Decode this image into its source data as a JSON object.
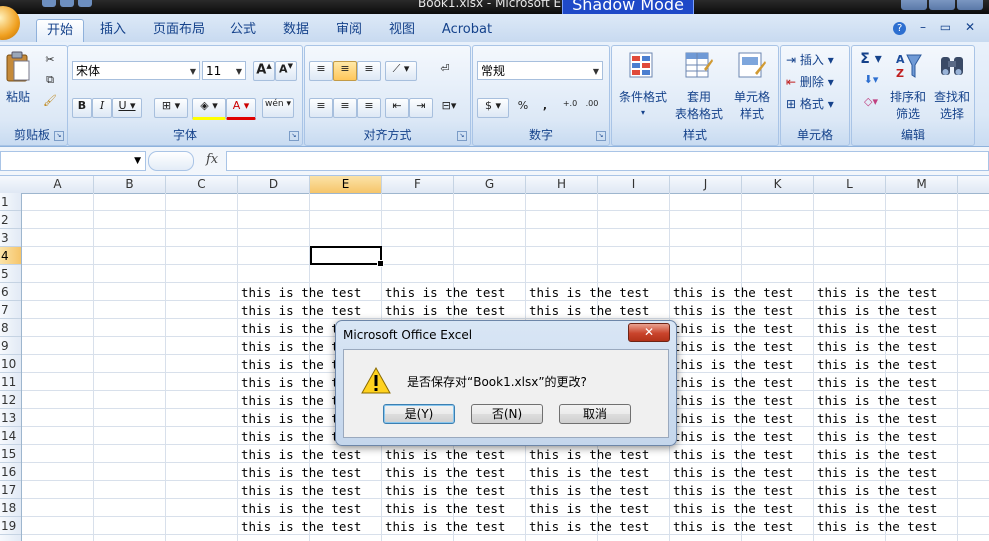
{
  "window": {
    "title": "Book1.xlsx - Microsoft E",
    "overlay_label": "Shadow Mode"
  },
  "tabs": [
    {
      "label": "开始",
      "active": true
    },
    {
      "label": "插入"
    },
    {
      "label": "页面布局"
    },
    {
      "label": "公式"
    },
    {
      "label": "数据"
    },
    {
      "label": "审阅"
    },
    {
      "label": "视图"
    },
    {
      "label": "Acrobat"
    }
  ],
  "ribbon": {
    "clipboard": {
      "label": "剪贴板",
      "paste_label": "粘贴"
    },
    "font": {
      "label": "字体",
      "font_name": "宋体",
      "font_size": "11"
    },
    "alignment": {
      "label": "对齐方式"
    },
    "number": {
      "label": "数字",
      "format": "常规",
      "percent": "%",
      "comma": ","
    },
    "styles": {
      "label": "样式",
      "conditional": "条件格式",
      "table_format_1": "套用",
      "table_format_2": "表格格式",
      "cell_styles_1": "单元格",
      "cell_styles_2": "样式"
    },
    "cells": {
      "label": "单元格",
      "insert": "插入",
      "delete": "删除",
      "format": "格式"
    },
    "editing": {
      "label": "编辑",
      "sum": "Σ",
      "sort_1": "排序和",
      "sort_2": "筛选",
      "find_1": "查找和",
      "find_2": "选择"
    }
  },
  "formula_bar": {
    "fx": "fx",
    "name_box": "",
    "formula": ""
  },
  "grid": {
    "columns": [
      "A",
      "B",
      "C",
      "D",
      "E",
      "F",
      "G",
      "H",
      "I",
      "J",
      "K",
      "L",
      "M"
    ],
    "rows": [
      "1",
      "2",
      "3",
      "4",
      "5",
      "6",
      "7",
      "8",
      "9",
      "10",
      "11",
      "12",
      "13",
      "14",
      "15",
      "16",
      "17",
      "18",
      "19"
    ],
    "selected_column": "E",
    "selected_row": "4",
    "active_cell": "E4",
    "cell_text": "this is the test"
  },
  "dialog": {
    "title": "Microsoft Office Excel",
    "close": "✕",
    "message": "是否保存对“Book1.xlsx”的更改?",
    "buttons": [
      {
        "label": "是(Y)",
        "default": true
      },
      {
        "label": "否(N)"
      },
      {
        "label": "取消"
      }
    ]
  }
}
